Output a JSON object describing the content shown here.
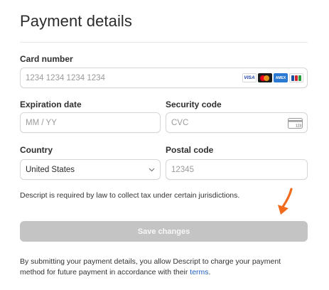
{
  "page": {
    "title": "Payment details"
  },
  "card_number": {
    "label": "Card number",
    "placeholder": "1234 1234 1234 1234",
    "brands": [
      "VISA",
      "Mastercard",
      "AMEX",
      "JCB"
    ],
    "amex_text": "AMEX",
    "visa_text": "VISA"
  },
  "expiration": {
    "label": "Expiration date",
    "placeholder": "MM / YY"
  },
  "security": {
    "label": "Security code",
    "placeholder": "CVC",
    "icon_text": "123"
  },
  "country": {
    "label": "Country",
    "value": "United States",
    "icon": "chevron-down-icon"
  },
  "postal": {
    "label": "Postal code",
    "placeholder": "12345"
  },
  "notice": "Descript is required by law to collect tax under certain jurisdictions.",
  "save_button": "Save changes",
  "footer": {
    "text": "By submitting your payment details, you allow Descript to charge your payment method for future payment in accordance with their",
    "link": "terms",
    "period": "."
  },
  "colors": {
    "button_disabled": "#c4c4c4",
    "link": "#1f5fbf",
    "annotation_arrow": "#f26a1b"
  }
}
